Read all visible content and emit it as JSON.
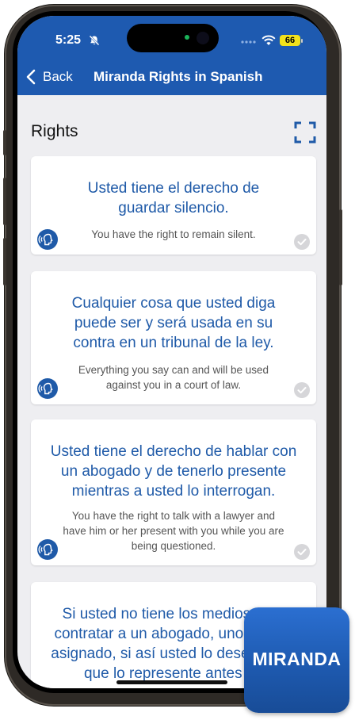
{
  "status_bar": {
    "time": "5:25",
    "battery": "66"
  },
  "nav": {
    "back_label": "Back",
    "title": "Miranda Rights in Spanish"
  },
  "section": {
    "title": "Rights"
  },
  "rights": [
    {
      "spanish": "Usted tiene el derecho de guardar silencio.",
      "english": "You have the right to remain silent."
    },
    {
      "spanish": "Cualquier cosa que usted diga puede ser y será usada en su contra en un tribunal de la ley.",
      "english": "Everything you say can and will be used against you in a court of law."
    },
    {
      "spanish": "Usted tiene el derecho de hablar con un abogado y de tenerlo presente mientras a usted lo interrogan.",
      "english": "You have the right to talk with a lawyer and have him or her present with you while you are being questioned."
    },
    {
      "spanish": "Si usted no tiene los medios para contratar a un abogado, uno le será asignado, si así usted lo desea, para que lo represente antes de",
      "english": ""
    }
  ],
  "badge": {
    "label": "MIRANDA"
  },
  "colors": {
    "header_blue": "#1e5ab0",
    "spanish_text": "#1f5aa8",
    "background": "#eeeef1"
  }
}
